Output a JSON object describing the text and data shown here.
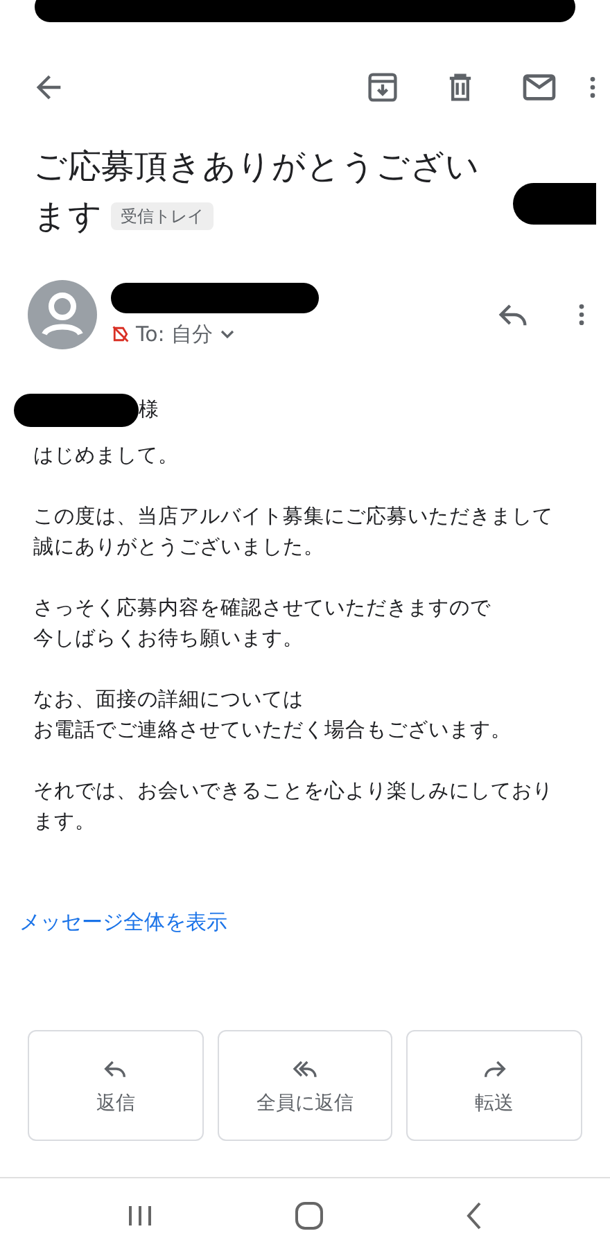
{
  "subject_lines": [
    "ご応募頂きありがとうござい",
    "ます"
  ],
  "label_chip": "受信トレイ",
  "recipient": "To: 自分",
  "greeting_suffix": "様",
  "body": [
    [
      "はじめまして。"
    ],
    [
      "この度は、当店アルバイト募集にご応募いただきまして",
      "誠にありがとうございました。"
    ],
    [
      "さっそく応募内容を確認させていただきますので",
      "今しばらくお待ち願います。"
    ],
    [
      "なお、面接の詳細については",
      "お電話でご連絡させていただく場合もございます。"
    ],
    [
      "それでは、お会いできることを心より楽しみにしており",
      "ます。"
    ]
  ],
  "show_full_link": "メッセージ全体を表示",
  "actions": [
    {
      "kind": "reply",
      "label": "返信"
    },
    {
      "kind": "reply_all",
      "label": "全員に返信"
    },
    {
      "kind": "forward",
      "label": "転送"
    }
  ]
}
